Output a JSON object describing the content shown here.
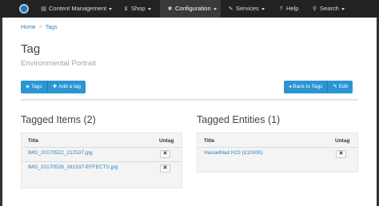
{
  "nav": {
    "items": [
      {
        "label": "Content Management",
        "icon": "folder-icon"
      },
      {
        "label": "Shop",
        "icon": "cart-icon"
      },
      {
        "label": "Configuration",
        "icon": "gear-icon"
      },
      {
        "label": "Services",
        "icon": "wrench-icon"
      },
      {
        "label": "Help",
        "icon": "question-icon"
      },
      {
        "label": "Search",
        "icon": "search-icon"
      }
    ],
    "active": "Configuration"
  },
  "breadcrumb": [
    "Home",
    "Tags"
  ],
  "page": {
    "title": "Tag",
    "subtitle": "Environmental Portrait"
  },
  "toolbar": {
    "tags_label": "Tags",
    "add_label": "Add a tag",
    "back_label": "Back to Tags",
    "edit_label": "Edit"
  },
  "tagged_items": {
    "heading": "Tagged Items (2)",
    "col_title": "Title",
    "col_untag": "Untag",
    "rows": [
      "IMG_20170522_212537.jpg",
      "IMG_20170528_161537-EFFECTS.jpg"
    ]
  },
  "tagged_entities": {
    "heading": "Tagged Entities (1)",
    "col_title": "Title",
    "col_untag": "Untag",
    "rows": [
      "Hasselblad H23 (£10000)"
    ]
  },
  "colors": {
    "navbar": "#222222",
    "primary_button": "#2a95d3",
    "link": "#2a83c2"
  }
}
